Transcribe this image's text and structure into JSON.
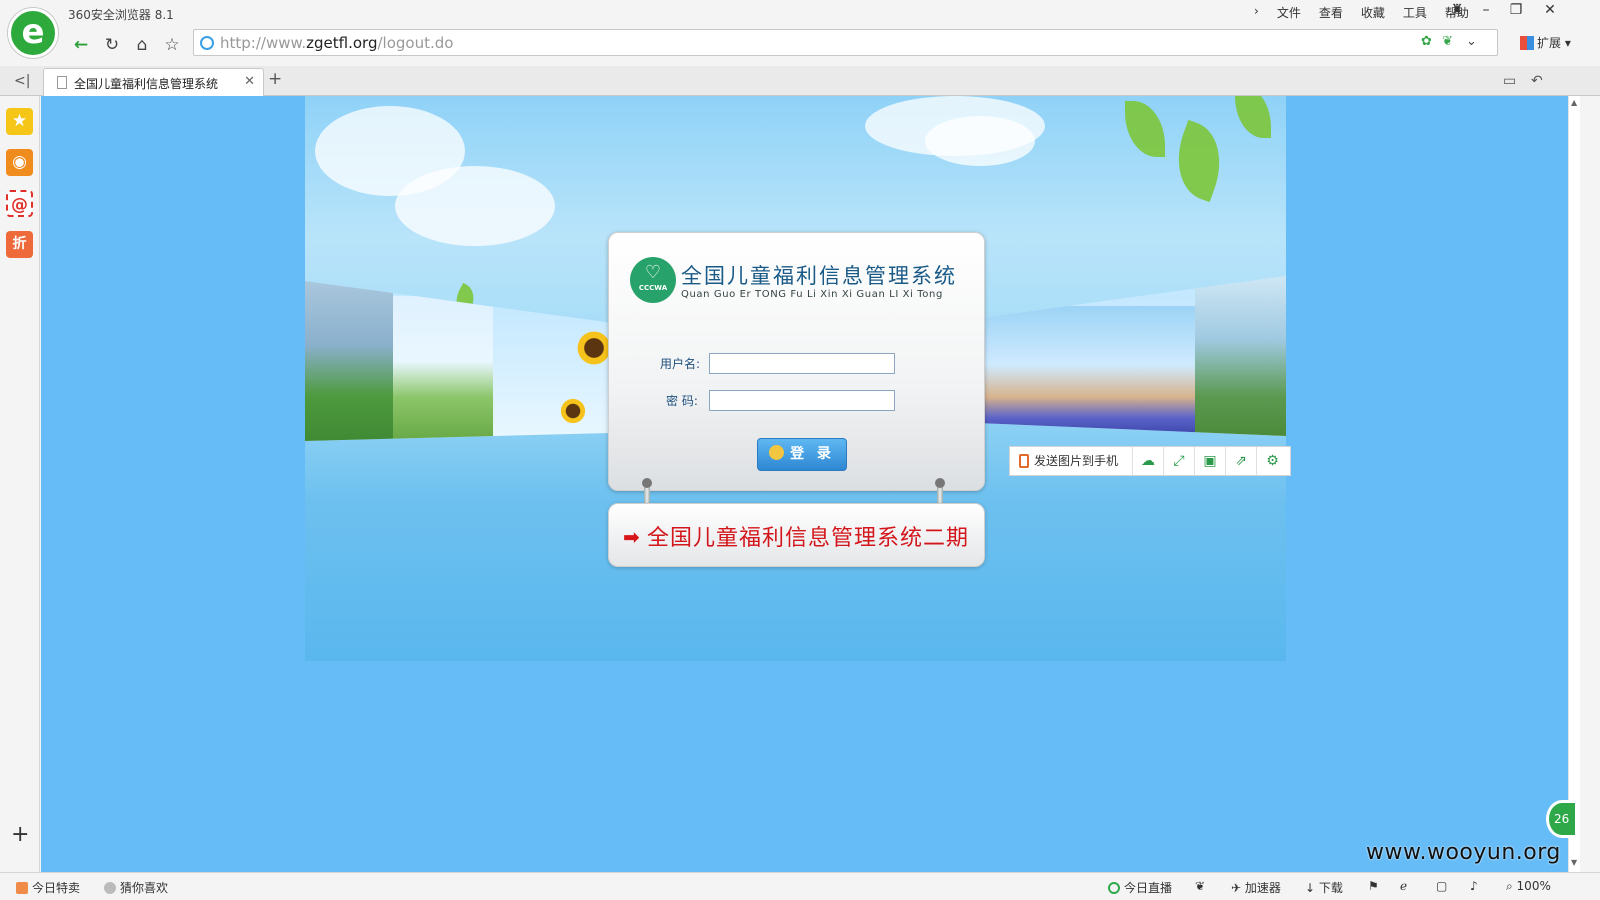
{
  "window": {
    "app_title": "360安全浏览器 8.1",
    "menu": [
      "文件",
      "查看",
      "收藏",
      "工具",
      "帮助"
    ],
    "logo_letter": "e"
  },
  "toolbar": {
    "url_scheme": "http://www.",
    "url_host": "zgetfl.org",
    "url_path": "/logout.do",
    "extensions_label": "扩展"
  },
  "tabs": [
    {
      "title": "全国儿童福利信息管理系统",
      "active": true
    }
  ],
  "sidebar": {
    "items": [
      "favorites-star",
      "weibo",
      "mail",
      "discount"
    ],
    "discount_label": "折"
  },
  "login": {
    "logo_text": "CCCWA",
    "title": "全国儿童福利信息管理系统",
    "subtitle": "Quan Guo Er TONG Fu Li Xin Xi Guan LI Xi Tong",
    "username_label": "用户名:",
    "password_label": "密 码:",
    "username_value": "",
    "password_value": "",
    "submit_label": "登 录"
  },
  "phase2_link": "全国儿童福利信息管理系统二期",
  "image_toolbar": {
    "send_label": "发送图片到手机"
  },
  "statusbar": {
    "left": [
      "今日特卖",
      "猜你喜欢"
    ],
    "right": [
      "今日直播",
      "加速器",
      "下载"
    ],
    "zoom": "100%"
  },
  "floatball_label": "26",
  "watermark": "www.wooyun.org",
  "colors": {
    "page_bg": "#66bcf7",
    "brand_green": "#2eaa3c",
    "title_blue": "#1a5a87",
    "phase2_red": "#d3161b"
  }
}
